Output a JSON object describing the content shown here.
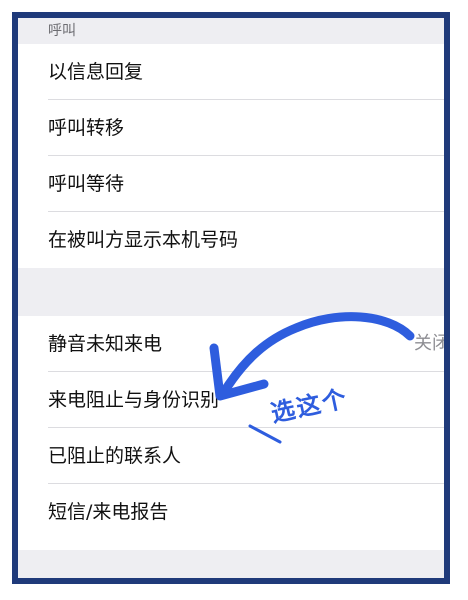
{
  "settings": {
    "section_title": "呼叫",
    "rows": [
      {
        "label": "以信息回复"
      },
      {
        "label": "呼叫转移"
      },
      {
        "label": "呼叫等待"
      },
      {
        "label": "在被叫方显示本机号码"
      }
    ],
    "rows2": [
      {
        "label": "静音未知来电",
        "value": "关闭"
      },
      {
        "label": "来电阻止与身份识别"
      },
      {
        "label": "已阻止的联系人"
      },
      {
        "label": "短信/来电报告"
      }
    ]
  },
  "annotation": {
    "text": "选这个",
    "color": "#2e5dde"
  }
}
